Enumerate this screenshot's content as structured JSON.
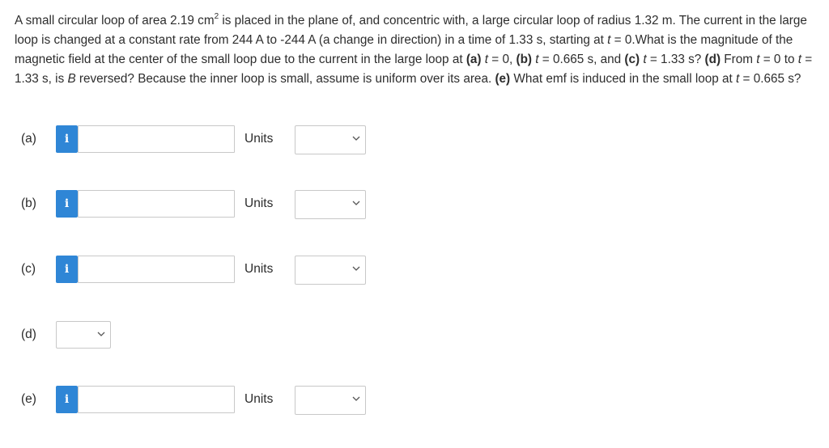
{
  "question": {
    "p1": "A small circular loop of area 2.19 cm",
    "p1_sup": "2",
    "p2": " is placed in the plane of, and concentric with, a large circular loop of radius 1.32 m. The current in the large loop is changed at a constant rate from 244 A to -244 A (a change in direction) in a time of 1.33 s, starting at ",
    "t1": "t",
    "p3": " = 0.What is the magnitude of the magnetic field at the center of the small loop due to the current in the large loop at ",
    "a_label": "(a)",
    "t2": " t",
    "p4": " = 0, ",
    "b_label": "(b)",
    "t3": " t",
    "p5": " = 0.665 s, and ",
    "c_label": "(c)",
    "t4": " t",
    "p6": " = 1.33 s? ",
    "d_label": "(d)",
    "p7": " From ",
    "t5": "t",
    "p8": " = 0 to ",
    "t6": "t",
    "p9": " = 1.33 s, is ",
    "B": "B",
    "p10": " reversed? Because the inner loop is small, assume is uniform over its area. ",
    "e_label": "(e)",
    "p11": " What emf is induced in the small loop at ",
    "t7": "t",
    "p12": " = 0.665 s?"
  },
  "parts": [
    {
      "label": "(a)",
      "info": "i",
      "value": "",
      "units_label": "Units",
      "units_value": ""
    },
    {
      "label": "(b)",
      "info": "i",
      "value": "",
      "units_label": "Units",
      "units_value": ""
    },
    {
      "label": "(c)",
      "info": "i",
      "value": "",
      "units_label": "Units",
      "units_value": ""
    },
    {
      "label": "(d)",
      "select_value": ""
    },
    {
      "label": "(e)",
      "info": "i",
      "value": "",
      "units_label": "Units",
      "units_value": ""
    }
  ],
  "icons": {
    "dropdown": "chevron-down-icon",
    "info": "info-icon"
  },
  "colors": {
    "info_button": "#2f86d6",
    "border": "#c8c8c8",
    "text": "#2b2b2b"
  }
}
